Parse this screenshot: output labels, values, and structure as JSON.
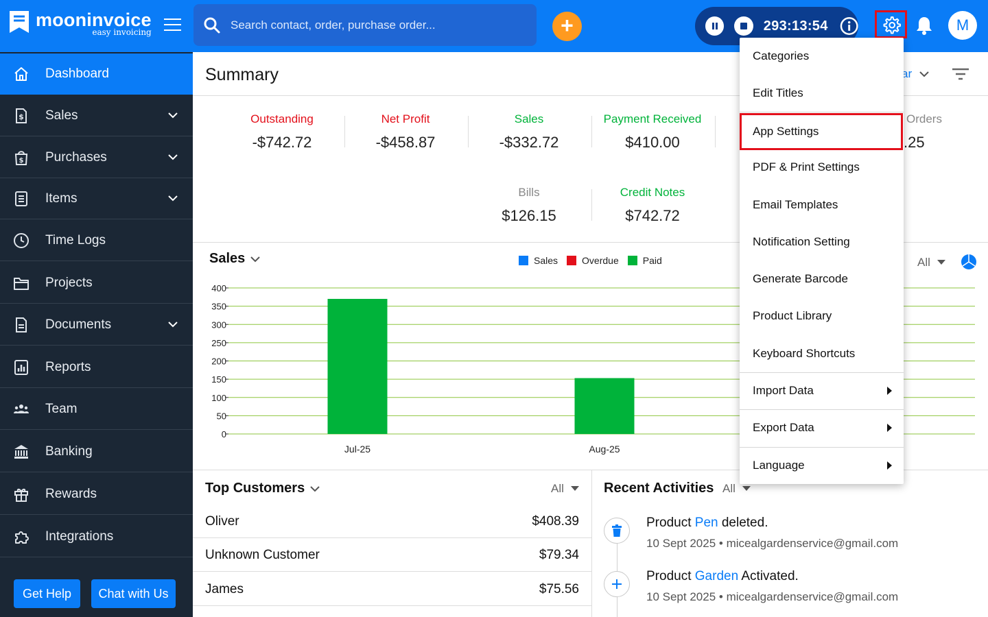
{
  "brand": {
    "name": "mooninvoice",
    "tagline": "easy invoicing",
    "accent": "#0a7cf7"
  },
  "search": {
    "placeholder": "Search contact, order, purchase order..."
  },
  "timer": {
    "value": "293:13:54"
  },
  "user": {
    "initial": "M"
  },
  "sidebar": {
    "items": [
      {
        "label": "Dashboard",
        "icon": "home-icon",
        "active": true
      },
      {
        "label": "Sales",
        "icon": "dollar-doc-icon",
        "expandable": true
      },
      {
        "label": "Purchases",
        "icon": "shopping-bag-icon",
        "expandable": true
      },
      {
        "label": "Items",
        "icon": "list-icon",
        "expandable": true
      },
      {
        "label": "Time Logs",
        "icon": "clock-icon"
      },
      {
        "label": "Projects",
        "icon": "folder-icon"
      },
      {
        "label": "Documents",
        "icon": "document-icon",
        "expandable": true
      },
      {
        "label": "Reports",
        "icon": "bar-chart-icon"
      },
      {
        "label": "Team",
        "icon": "team-icon"
      },
      {
        "label": "Banking",
        "icon": "bank-icon"
      },
      {
        "label": "Rewards",
        "icon": "gift-icon"
      },
      {
        "label": "Integrations",
        "icon": "puzzle-icon"
      }
    ],
    "help_label": "Get Help",
    "chat_label": "Chat with Us"
  },
  "summary": {
    "title": "Summary",
    "period_suffix": "ar",
    "stats": [
      {
        "label": "Outstanding",
        "value": "-$742.72",
        "color": "#e3101b"
      },
      {
        "label": "Net Profit",
        "value": "-$458.87",
        "color": "#e3101b"
      },
      {
        "label": "Sales",
        "value": "-$332.72",
        "color": "#00b33a"
      },
      {
        "label": "Payment Received",
        "value": "$410.00",
        "color": "#00b33a"
      },
      {
        "label": "Bills",
        "value": "$126.15",
        "color": "#888888"
      },
      {
        "label": "Credit Notes",
        "value": "$742.72",
        "color": "#00b33a"
      }
    ],
    "partial_label": "Orders",
    "partial_value": ".25"
  },
  "sales_section": {
    "title": "Sales",
    "filter": "All"
  },
  "chart_data": {
    "type": "bar",
    "categories": [
      "Jul-25",
      "Aug-25"
    ],
    "series": [
      {
        "name": "Sales",
        "color": "#0a7cf7",
        "values": [
          0,
          0
        ]
      },
      {
        "name": "Overdue",
        "color": "#e3101b",
        "values": [
          0,
          0
        ]
      },
      {
        "name": "Paid",
        "color": "#00b33a",
        "values": [
          370,
          153
        ]
      }
    ],
    "ylim": [
      0,
      400
    ],
    "yticks": [
      0,
      50,
      100,
      150,
      200,
      250,
      300,
      350,
      400
    ],
    "grid": true,
    "grid_color": "#8ec63f",
    "legend": "top-center"
  },
  "top_customers": {
    "title": "Top Customers",
    "filter": "All",
    "rows": [
      {
        "name": "Oliver",
        "amount": "$408.39"
      },
      {
        "name": "Unknown Customer",
        "amount": "$79.34"
      },
      {
        "name": "James",
        "amount": "$75.56"
      }
    ]
  },
  "recent_activities": {
    "title": "Recent Activities",
    "filter": "All",
    "items": [
      {
        "prefix": "Product ",
        "link": "Pen",
        "suffix": " deleted.",
        "date": "10 Sept 2025",
        "email": "micealgardenservice@gmail.com",
        "icon": "trash-icon"
      },
      {
        "prefix": "Product ",
        "link": "Garden",
        "suffix": " Activated.",
        "date": "10 Sept 2025",
        "email": "micealgardenservice@gmail.com",
        "icon": "plus-icon"
      }
    ]
  },
  "settings_menu": {
    "items": [
      {
        "label": "Categories"
      },
      {
        "label": "Edit Titles"
      },
      {
        "label": "App Settings",
        "highlighted": true
      },
      {
        "label": "PDF & Print Settings"
      },
      {
        "label": "Email Templates"
      },
      {
        "label": "Notification Setting"
      },
      {
        "label": "Generate Barcode"
      },
      {
        "label": "Product Library"
      },
      {
        "label": "Keyboard Shortcuts"
      },
      {
        "label": "Import Data",
        "submenu": true
      },
      {
        "label": "Export Data",
        "submenu": true
      },
      {
        "label": "Language",
        "submenu": true
      }
    ]
  }
}
